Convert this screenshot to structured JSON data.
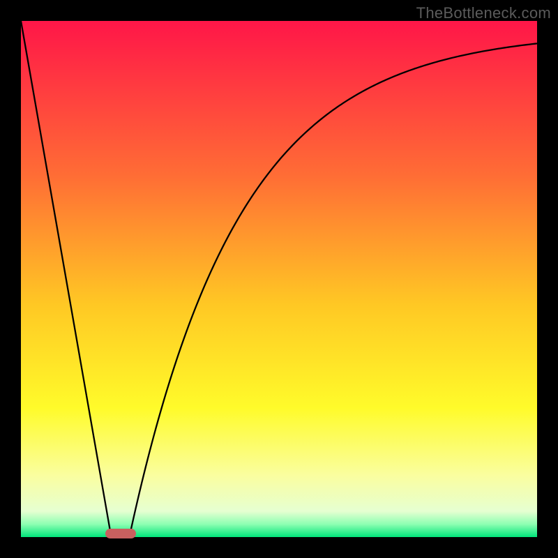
{
  "watermark": "TheBottleneck.com",
  "chart_data": {
    "type": "line",
    "title": "",
    "xlabel": "",
    "ylabel": "",
    "xlim": [
      0,
      100
    ],
    "ylim": [
      0,
      100
    ],
    "grid": false,
    "legend": false,
    "annotations": [],
    "background_gradient": {
      "stops": [
        {
          "pos": 0.0,
          "color": "#ff1648"
        },
        {
          "pos": 0.3,
          "color": "#ff6d35"
        },
        {
          "pos": 0.55,
          "color": "#ffc824"
        },
        {
          "pos": 0.75,
          "color": "#fffb2a"
        },
        {
          "pos": 0.88,
          "color": "#fafe9f"
        },
        {
          "pos": 0.95,
          "color": "#e6ffd1"
        },
        {
          "pos": 0.975,
          "color": "#8dffb2"
        },
        {
          "pos": 1.0,
          "color": "#00e57a"
        }
      ]
    },
    "curve1": {
      "description": "steep descending line from top-left toward minimum",
      "x": [
        0,
        17.5
      ],
      "y": [
        100,
        0
      ]
    },
    "curve2": {
      "description": "ascending saturating curve from minimum toward upper right",
      "x": [
        21,
        30,
        40,
        50,
        60,
        70,
        80,
        90,
        100
      ],
      "y": [
        0,
        35,
        60,
        73,
        81,
        86,
        89.5,
        92,
        94
      ]
    },
    "minimum_marker": {
      "x_center": 19.3,
      "width": 6,
      "color": "#c9605f"
    }
  }
}
